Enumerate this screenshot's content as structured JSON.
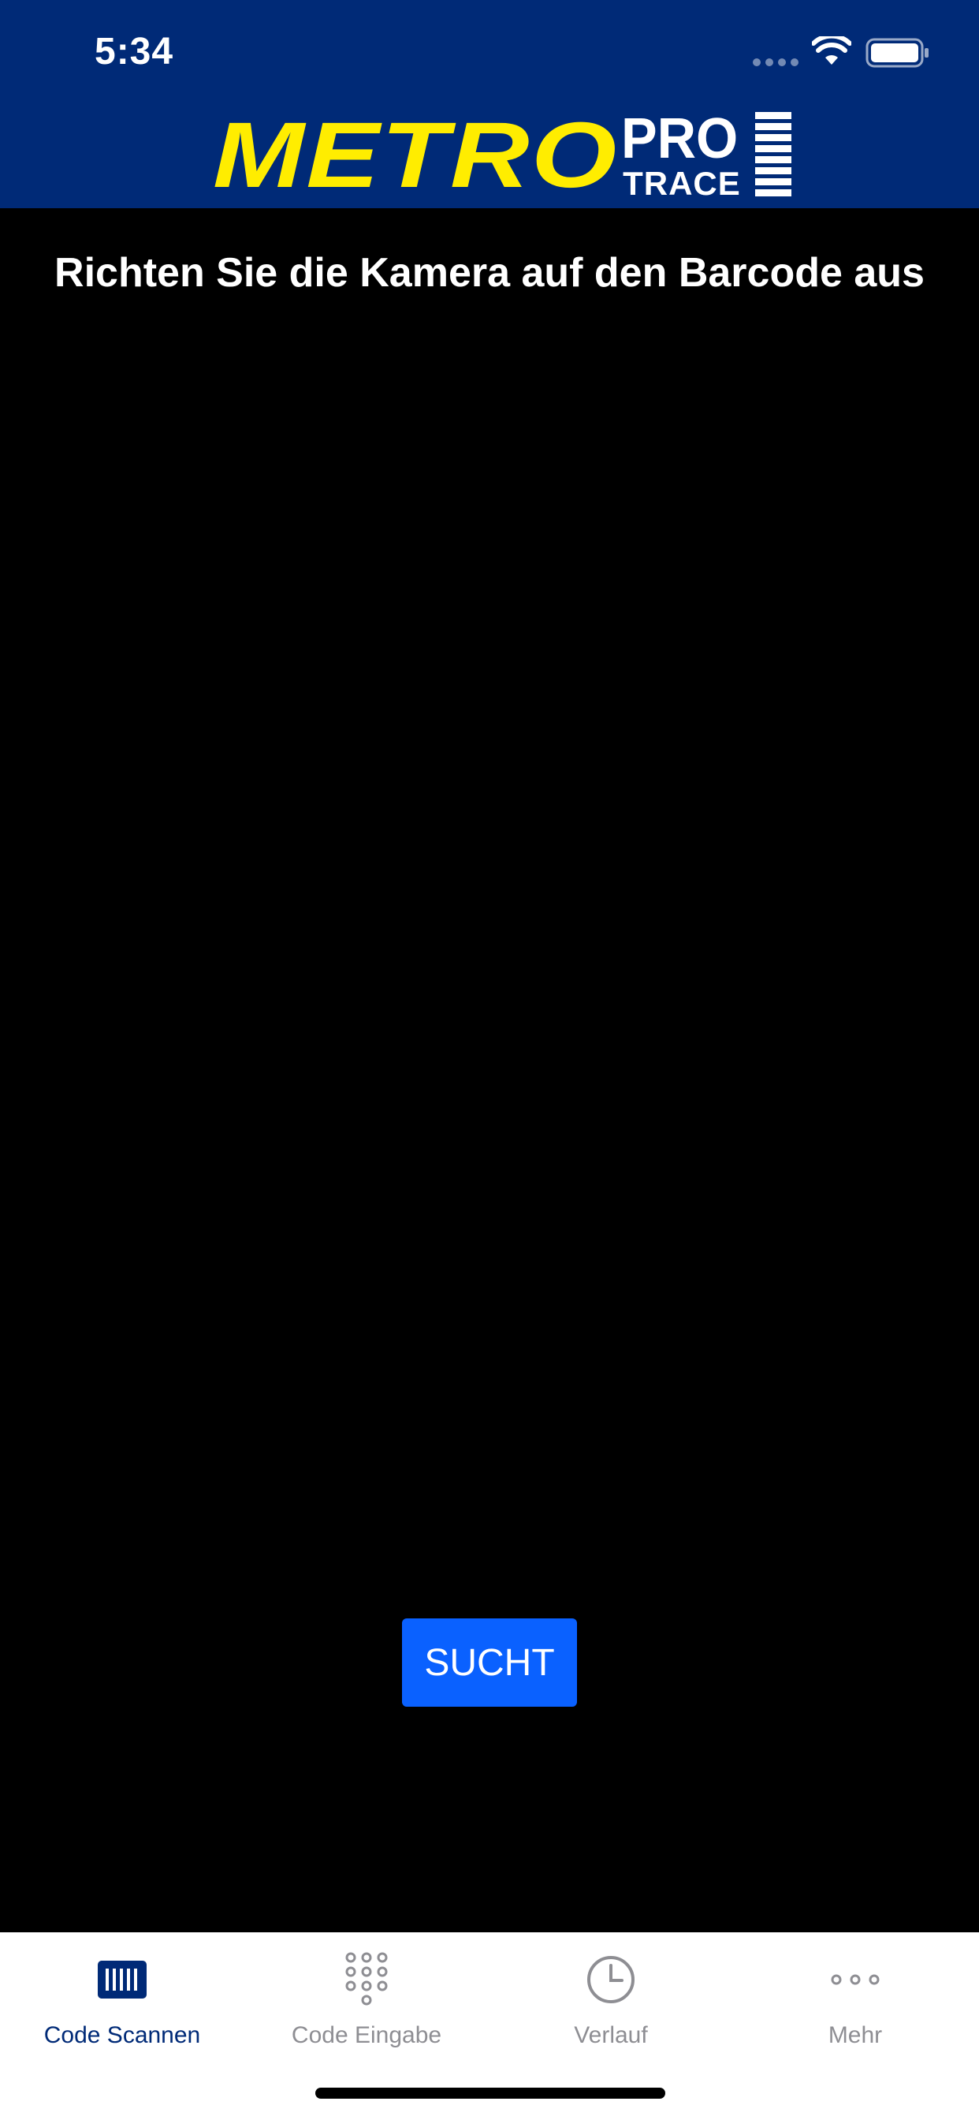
{
  "status_bar": {
    "time": "5:34",
    "signal_icon": "cellular-signal-icon",
    "wifi_icon": "wifi-icon",
    "battery_icon": "battery-icon"
  },
  "header": {
    "logo_primary": "METRO",
    "logo_pro": "PRO",
    "logo_trace": "TRACE",
    "background_color": "#002a77",
    "logo_color": "#ffed00"
  },
  "scanner": {
    "instruction": "Richten Sie die Kamera auf den Barcode aus",
    "search_button_label": "SUCHT",
    "button_color": "#0a61ff"
  },
  "tab_bar": {
    "active_color": "#002a77",
    "inactive_color": "#8e8e93",
    "tabs": [
      {
        "label": "Code Scannen",
        "icon": "barcode-scan-icon",
        "active": true
      },
      {
        "label": "Code Eingabe",
        "icon": "keypad-icon",
        "active": false
      },
      {
        "label": "Verlauf",
        "icon": "clock-icon",
        "active": false
      },
      {
        "label": "Mehr",
        "icon": "more-dots-icon",
        "active": false
      }
    ]
  }
}
